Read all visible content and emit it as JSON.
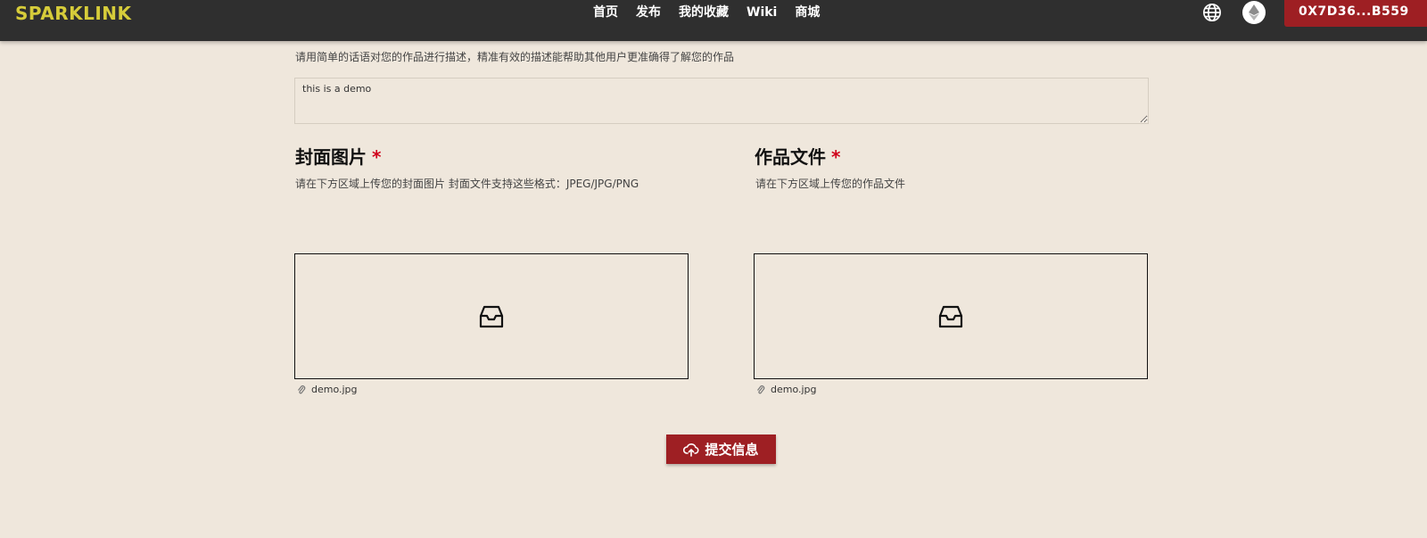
{
  "nav": {
    "logo": "SPARKLINK",
    "links": [
      {
        "label": "首页"
      },
      {
        "label": "发布",
        "active": true
      },
      {
        "label": "我的收藏"
      },
      {
        "label": "Wiki"
      },
      {
        "label": "商城"
      }
    ],
    "wallet_address": "0X7D36...B559"
  },
  "description": {
    "hint": "请用简单的话语对您的作品进行描述，精准有效的描述能帮助其他用户更准确得了解您的作品",
    "value": "this is a demo"
  },
  "cover": {
    "title": "封面图片",
    "required_mark": "*",
    "hint": "请在下方区域上传您的封面图片 封面文件支持这些格式：JPEG/JPG/PNG",
    "file_name": "demo.jpg"
  },
  "work": {
    "title": "作品文件",
    "required_mark": "*",
    "hint": "请在下方区域上传您的作品文件",
    "file_name": "demo.jpg"
  },
  "submit_label": "提交信息",
  "colors": {
    "nav_bg": "#2f2f2f",
    "logo": "#d6cc3a",
    "accent": "#9e1f23",
    "page_bg": "#efe7dc",
    "required": "#d0021b"
  }
}
